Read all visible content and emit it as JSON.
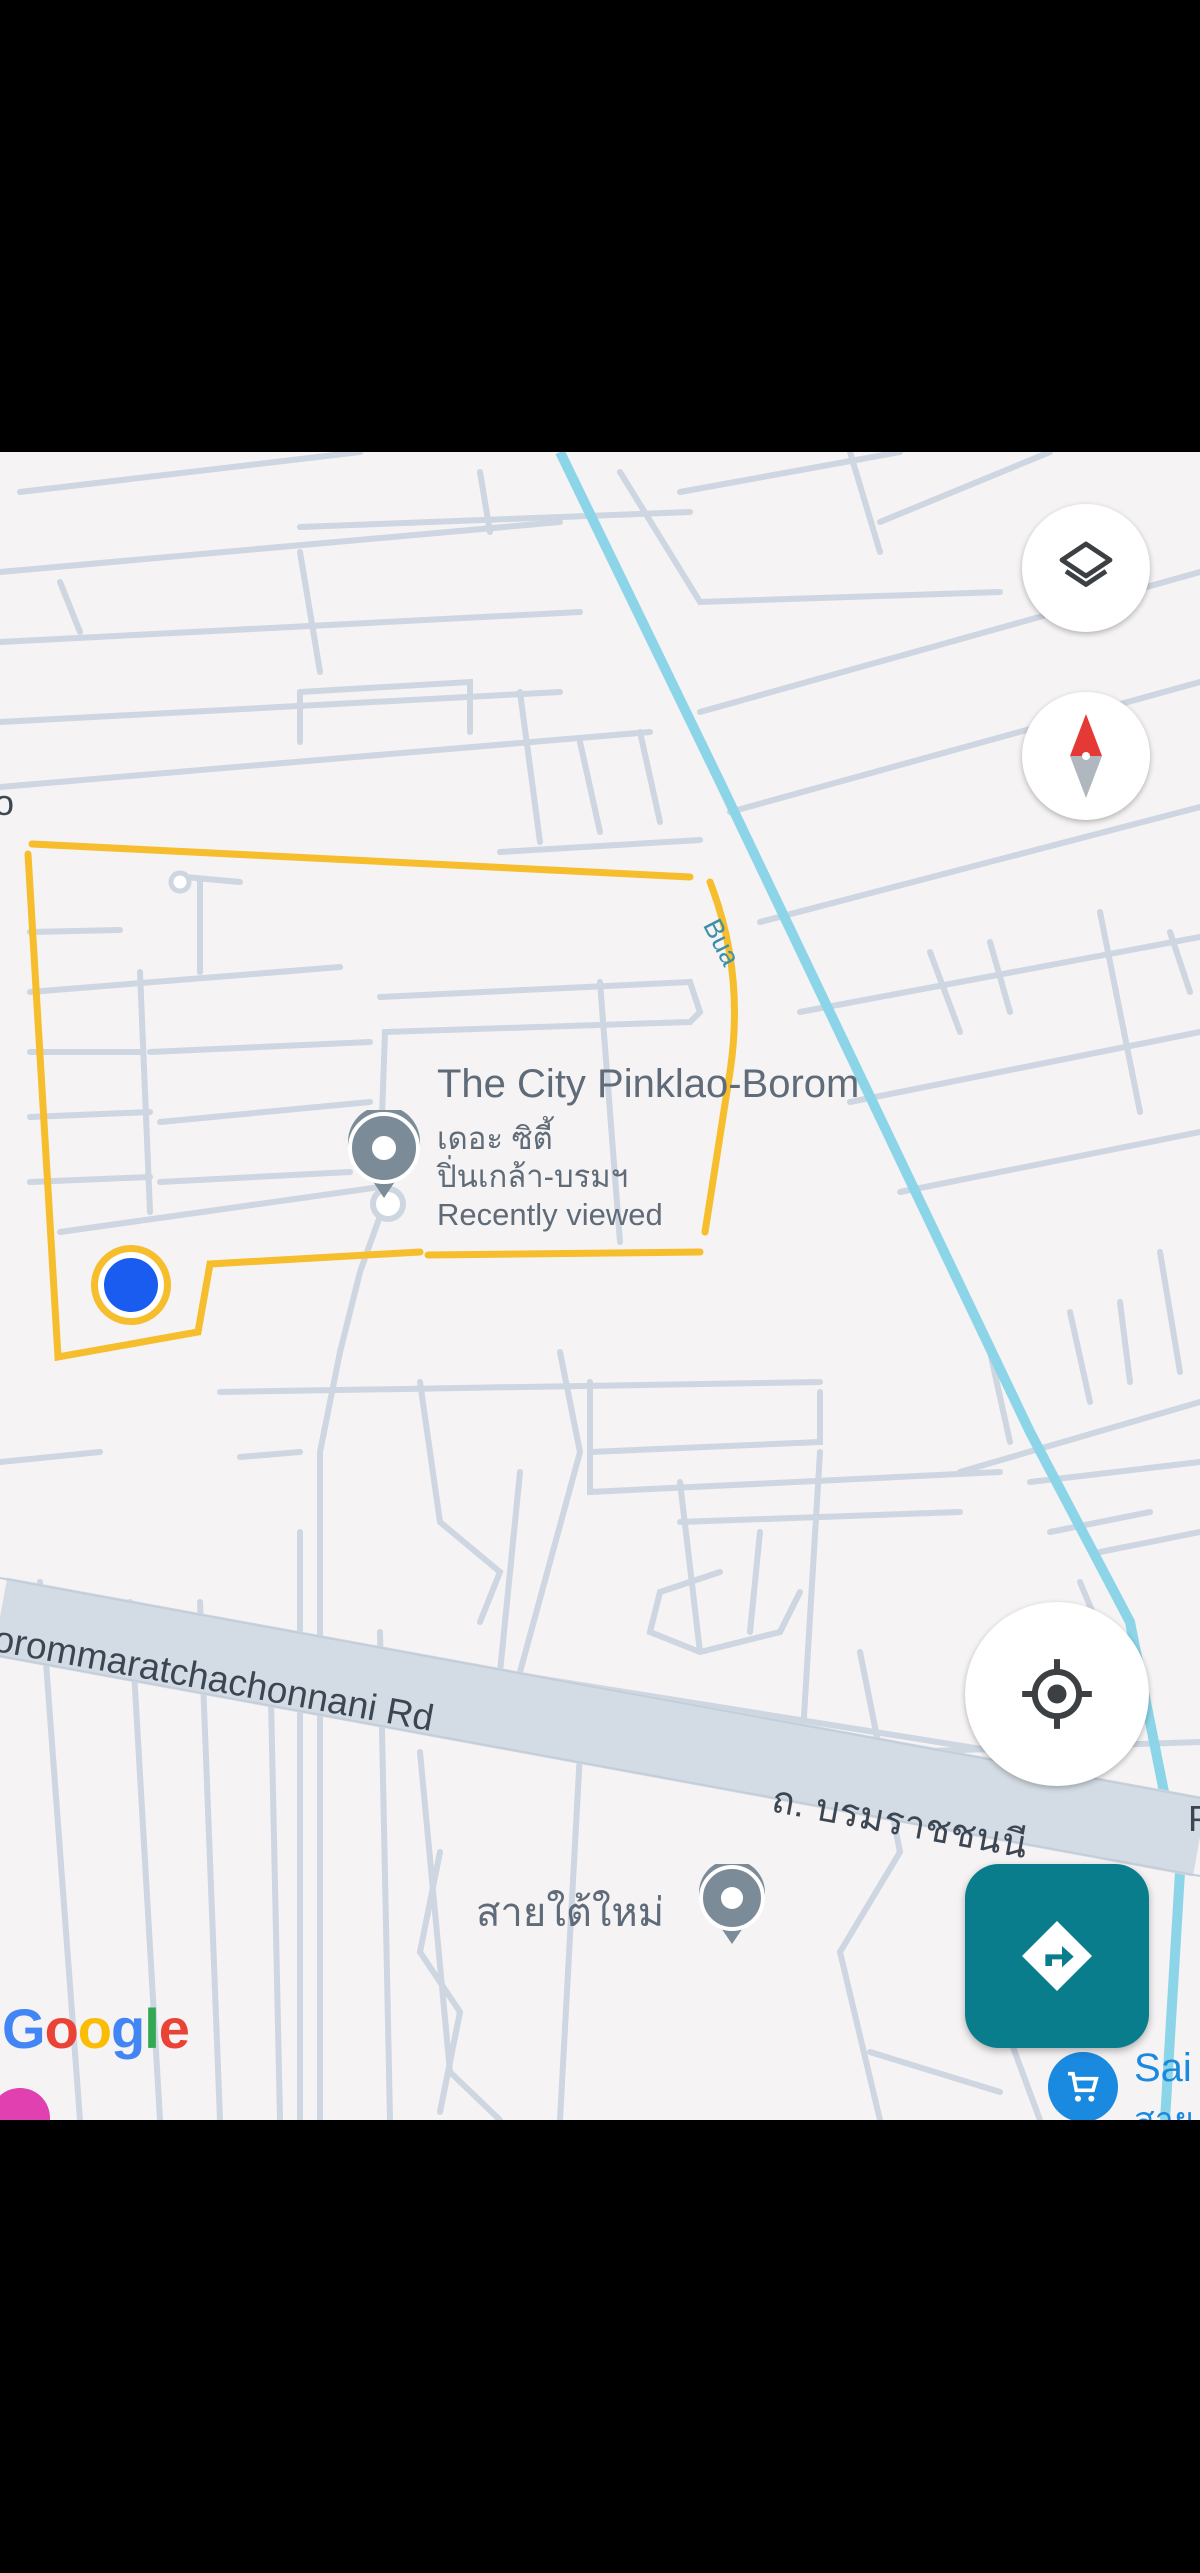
{
  "map": {
    "poi": {
      "title": "The City Pinklao-Borom",
      "subtitle_line1": "เดอะ ซิตี้",
      "subtitle_line2": "ปิ่นเกล้า-บรมฯ",
      "recent": "Recently viewed"
    },
    "road_main_en": "Borommaratchachonnani Rd",
    "road_main_en_visible": "orommaratchachonnani Rd",
    "road_main_th": "ถ. บรมราชชนนี",
    "canal_label": "Bua",
    "poi2_label": "สายใต้ใหม่",
    "shop_label": "Sai",
    "shop_label_th": "สาย",
    "left_edge_fragment": "o",
    "right_edge_fragment": "P",
    "attribution": [
      "G",
      "o",
      "o",
      "g",
      "l",
      "e"
    ],
    "attribution_colors": [
      "#4285F4",
      "#EA4335",
      "#FBBC05",
      "#4285F4",
      "#34A853",
      "#EA4335"
    ],
    "controls": {
      "layers": "layers-icon",
      "compass": "compass-icon",
      "locate": "my-location-icon",
      "directions": "directions-icon"
    },
    "colors": {
      "boundary": "#f6bd2c",
      "water": "#8cd5e8",
      "road": "#cfd8e3",
      "my_location": "#1a5cf0",
      "directions_fab": "#0a7d8c"
    }
  }
}
